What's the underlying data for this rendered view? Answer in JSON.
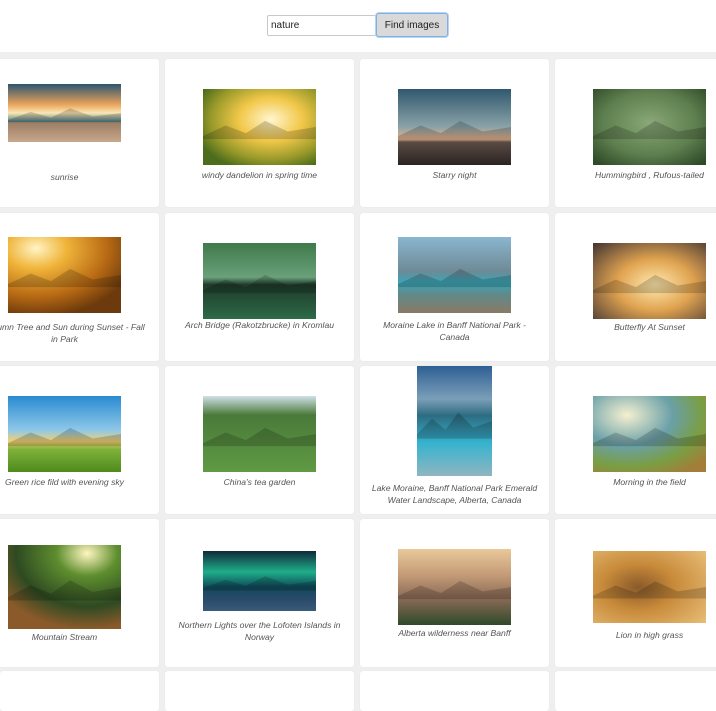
{
  "search": {
    "value": "nature",
    "button_label": "Find images"
  },
  "images": [
    {
      "caption": "sunrise",
      "icon": "sunrise-landscape-image"
    },
    {
      "caption": "windy dandelion in spring time",
      "icon": "dandelion-image"
    },
    {
      "caption": "Starry night",
      "icon": "starry-night-image"
    },
    {
      "caption": "Hummingbird , Rufous-tailed",
      "icon": "hummingbird-image"
    },
    {
      "caption": "Autumn Tree and Sun during Sunset - Fall in Park",
      "icon": "autumn-tree-image"
    },
    {
      "caption": "Arch Bridge (Rakotzbrucke) in Kromlau",
      "icon": "arch-bridge-image"
    },
    {
      "caption": "Moraine Lake in Banff National Park - Canada",
      "icon": "moraine-lake-image"
    },
    {
      "caption": "Butterfly At Sunset",
      "icon": "butterfly-image"
    },
    {
      "caption": "Green rice fild with evening sky",
      "icon": "rice-field-image"
    },
    {
      "caption": "China's tea garden",
      "icon": "tea-garden-image"
    },
    {
      "caption": "Lake Moraine, Banff National Park Emerald Water Landscape, Alberta, Canada",
      "icon": "lake-moraine-image"
    },
    {
      "caption": "Morning in the field",
      "icon": "field-morning-image"
    },
    {
      "caption": "Mountain Stream",
      "icon": "mountain-stream-image"
    },
    {
      "caption": "Northern Lights over the Lofoten Islands in Norway",
      "icon": "northern-lights-image"
    },
    {
      "caption": "Alberta wilderness near Banff",
      "icon": "alberta-wilderness-image"
    },
    {
      "caption": "Lion in high grass",
      "icon": "lion-image"
    }
  ]
}
